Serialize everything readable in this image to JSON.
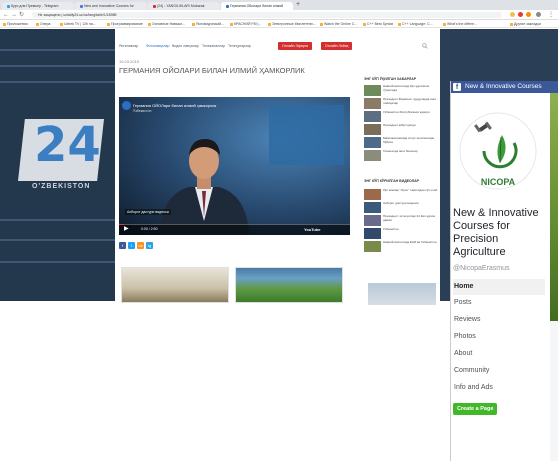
{
  "browser": {
    "tabs": [
      {
        "label": "Курс для Премьер - Telegram",
        "color": "#2aa3e0"
      },
      {
        "label": "New and Innovative Courses for",
        "color": "#4c7bd6"
      },
      {
        "label": "(24) - YANGILIKLAR/ Mubarak",
        "color": "#d32f2f"
      },
      {
        "label": "Германия Ойолари билан илмий",
        "color": "#2a6fc1"
      }
    ],
    "url": "Не защищено | uzdaily24.uz/uz/lang/tahir/1/18985",
    "bookmarks": [
      "Приложения",
      "Опера",
      "Uzbek TV | 12h на...",
      "Программирование",
      "Основные Навыки...",
      "Ясновидческий...",
      "КРАСНИЙ FM |...",
      "Электронные бюллетени...",
      "Watch the Online C...",
      "C++ Best Syntax",
      "C++ Language: C...",
      "What's the differe...",
      "Другие закладки"
    ]
  },
  "site": {
    "nav": [
      "Янгиликлар",
      "Фотолавҳалар",
      "Видео лавҳалар",
      "Телеканаллар",
      "Телеҳунарлар"
    ],
    "buttons": [
      "Онлайн Эфирга",
      "Онлайн Лойиҳ"
    ],
    "logo_text": "24",
    "logo_sub": "O'ZBEKISTON"
  },
  "article": {
    "date": "19.03.2019",
    "title": "ГЕРМАНИЯ ОЙОЛАРИ БИЛАН ИЛМИЙ ҲАМКОРЛИК",
    "video": {
      "title": "Германия ОЙОЛари билан илмий ҳамкорлик",
      "channel": "Ўзбекистон",
      "caption": "Ахборот дастури видеоси",
      "time": "0:00 / 2:50",
      "platform": "YouTube",
      "progress": 0.02
    },
    "share_buttons": [
      "f",
      "t",
      "ok",
      "tg"
    ],
    "share_colors": [
      "#3b5998",
      "#1da1f2",
      "#f7931e",
      "#2aa3e0"
    ]
  },
  "sidebar": {
    "heading_news": "ЭНГ КЎП ЎҚИЛГАН ХАБАРЛАР",
    "heading_video": "ЭНГ КЎП КЎРИЛГАН ВИДЕОЛАР",
    "news": [
      "Навоий вилоятида йўл қурилиши тўғрисида",
      "Президент Фармони: ҳудудларда янги лойиҳалар",
      "Ўзбекистон Республикаси қарори",
      "Президент қабул қилди",
      "Мамлакатимизда спорт янгиликлари бўйича",
      "Тошкентда янги бинолар"
    ],
    "videos": [
      "Кўп кимлар \"Орол\" тарихидан сўз очиб",
      "Ахборот дастури видеоси",
      "Президент: ислоҳотлар 24 йил қуриш давом",
      "Ўзбекистон",
      "Навоий вилоятида ЕАЙ ва Ўзбекистон"
    ]
  },
  "facebook": {
    "title": "New & Innovative Courses",
    "page_name": "New & Innovative Courses for Precision Agriculture",
    "handle": "@NicopaErasmus",
    "logo_text": "NICOPA",
    "menu": [
      "Home",
      "Posts",
      "Reviews",
      "Photos",
      "About",
      "Community",
      "Info and Ads"
    ],
    "active_menu": "Home",
    "create_page": "Create a Page",
    "brand_color": "#3b5998"
  }
}
